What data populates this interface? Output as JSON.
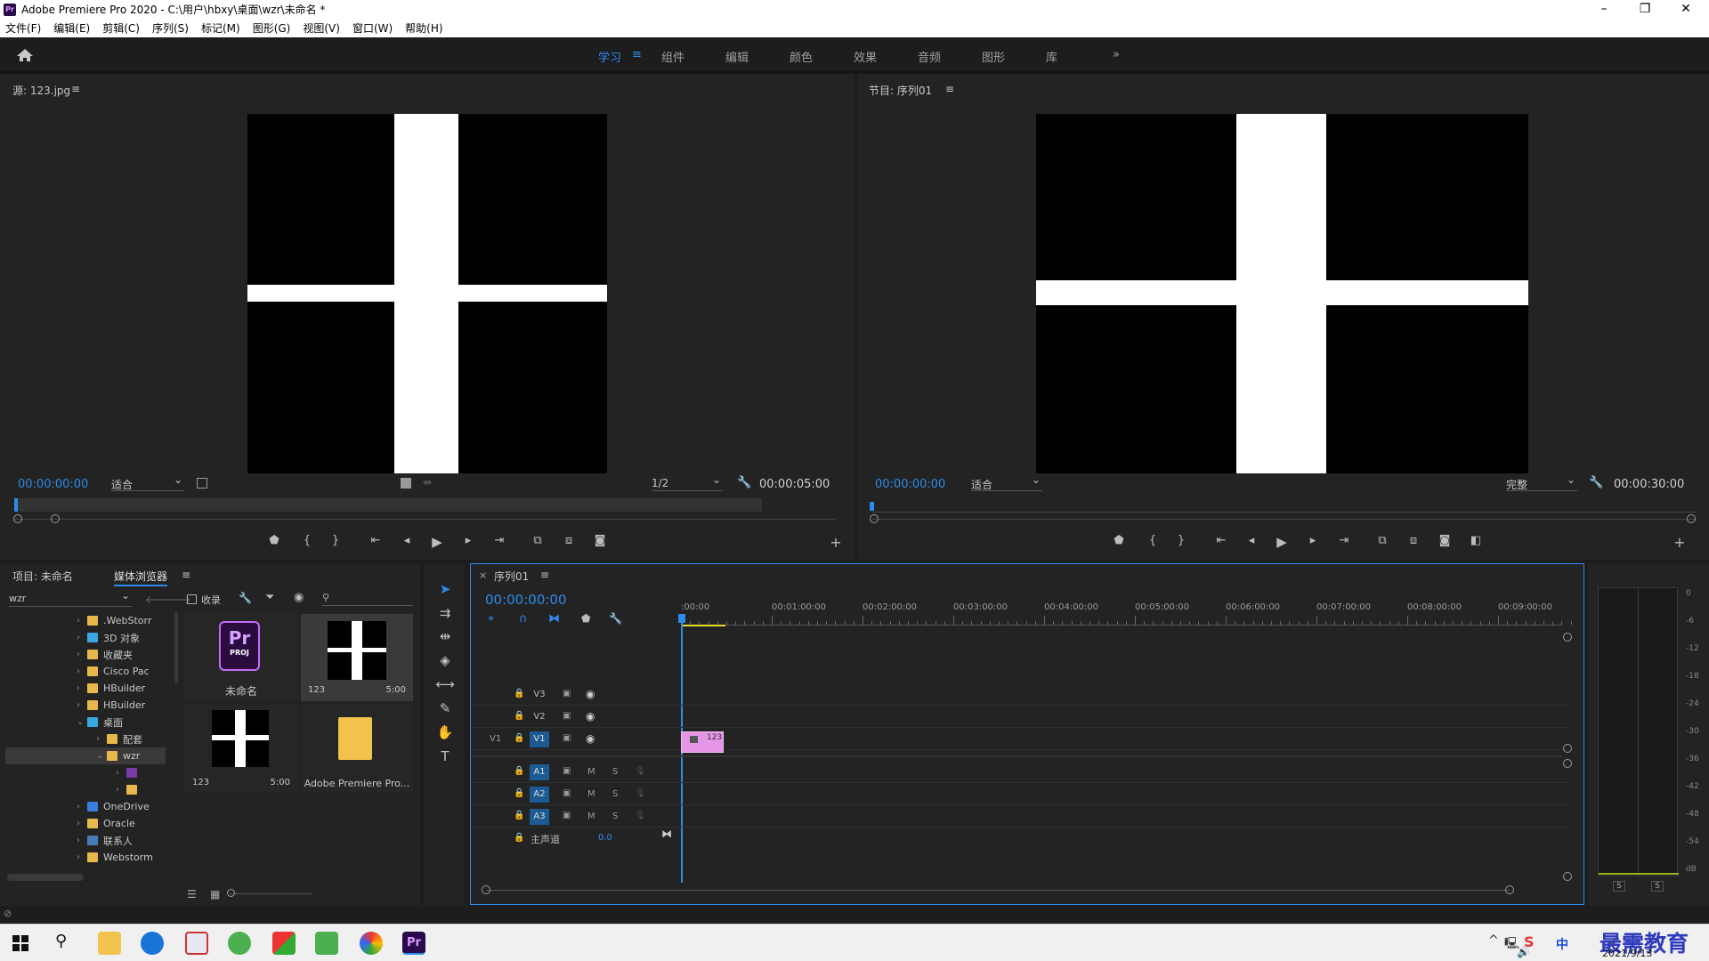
{
  "window": {
    "title": "Adobe Premiere Pro 2020 - C:\\用户\\hbxy\\桌面\\wzr\\未命名 *",
    "minimize": "–",
    "maximize": "❐",
    "close": "✕"
  },
  "menu": [
    "文件(F)",
    "编辑(E)",
    "剪辑(C)",
    "序列(S)",
    "标记(M)",
    "图形(G)",
    "视图(V)",
    "窗口(W)",
    "帮助(H)"
  ],
  "workspaces": {
    "tabs": [
      "学习",
      "组件",
      "编辑",
      "颜色",
      "效果",
      "音频",
      "图形",
      "库"
    ],
    "active": "学习",
    "more": "»",
    "menu": "≡"
  },
  "source": {
    "title": "源: 123.jpg",
    "menu": "≡",
    "timecode": "00:00:00:00",
    "fit": "适合",
    "resolution": "1/2",
    "duration": "00:00:05:00"
  },
  "program": {
    "title": "节目: 序列01",
    "menu": "≡",
    "timecode": "00:00:00:00",
    "fit": "适合",
    "quality": "完整",
    "duration": "00:00:30:00"
  },
  "project": {
    "tabs": [
      "项目: 未命名",
      "媒体浏览器"
    ],
    "active": "媒体浏览器",
    "menu": "≡",
    "location": "wzr",
    "ingest": "收录",
    "tree": [
      {
        "label": ".WebStorr",
        "icon": "folder"
      },
      {
        "label": "3D 对象",
        "icon": "3d-object"
      },
      {
        "label": "收藏夹",
        "icon": "star"
      },
      {
        "label": "Cisco Pac",
        "icon": "folder"
      },
      {
        "label": "HBuilder",
        "icon": "folder"
      },
      {
        "label": "HBuilder",
        "icon": "folder"
      },
      {
        "label": "桌面",
        "icon": "desktop",
        "expanded": true
      },
      {
        "label": "配套",
        "icon": "folder",
        "indent": 1
      },
      {
        "label": "wzr",
        "icon": "folder",
        "indent": 1,
        "selected": true,
        "expanded": true
      },
      {
        "label": "",
        "icon": "premiere-file",
        "indent": 2
      },
      {
        "label": "",
        "icon": "folder",
        "indent": 2
      },
      {
        "label": "OneDrive",
        "icon": "cloud"
      },
      {
        "label": "Oracle",
        "icon": "folder"
      },
      {
        "label": "联系人",
        "icon": "contacts"
      },
      {
        "label": "Webstorm",
        "icon": "folder"
      }
    ],
    "items": [
      {
        "name": "未命名",
        "type": "proj",
        "duration": ""
      },
      {
        "name": "123",
        "type": "image",
        "duration": "5:00"
      },
      {
        "name": "123",
        "type": "image",
        "duration": "5:00"
      },
      {
        "name": "Adobe Premiere Pro...",
        "type": "folder",
        "duration": ""
      }
    ],
    "pr_label": "Pr",
    "proj_label": "PROJ"
  },
  "timeline": {
    "tab": "序列01",
    "close": "×",
    "menu": "≡",
    "timecode": "00:00:00:00",
    "ruler": [
      ":00:00",
      "00:01:00:00",
      "00:02:00:00",
      "00:03:00:00",
      "00:04:00:00",
      "00:05:00:00",
      "00:06:00:00",
      "00:07:00:00",
      "00:08:00:00",
      "00:09:00:00"
    ],
    "video_tracks": [
      "V3",
      "V2",
      "V1"
    ],
    "audio_tracks": [
      "A1",
      "A2",
      "A3"
    ],
    "source_patch": "V1",
    "mute": "M",
    "solo": "S",
    "master": "主声道",
    "master_value": "0.0",
    "clip_name": "123"
  },
  "meter": {
    "labels": [
      "0",
      "-6",
      "-12",
      "-18",
      "-24",
      "-30",
      "-36",
      "-42",
      "-48",
      "-54",
      "dB"
    ],
    "solo": [
      "S",
      "S"
    ]
  },
  "taskbar": {
    "date": "2021/9/13",
    "ime": "中",
    "watermark": "最需教育"
  },
  "colors": {
    "accent": "#2d8ceb",
    "clip": "#e596e6",
    "panel": "#232323",
    "track_active": "#1b5a92"
  }
}
